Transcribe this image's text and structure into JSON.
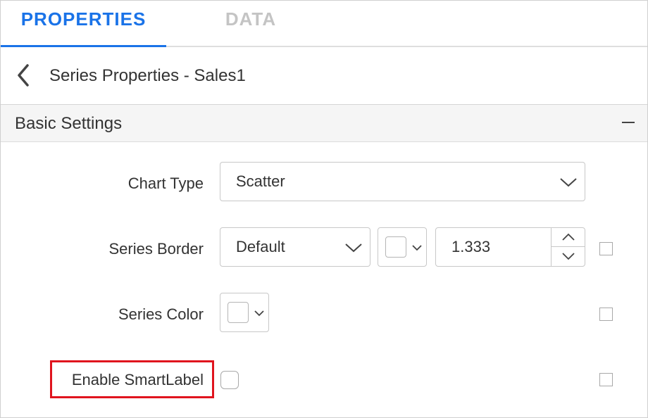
{
  "tabs": {
    "properties_label": "PROPERTIES",
    "data_label": "DATA"
  },
  "header": {
    "title": "Series Properties - Sales1",
    "back_icon": "chevron-left-icon"
  },
  "section": {
    "title": "Basic Settings",
    "collapse_icon": "minus-icon"
  },
  "fields": {
    "chart_type": {
      "label": "Chart Type",
      "value": "Scatter"
    },
    "series_border": {
      "label": "Series Border",
      "style_value": "Default",
      "color": "#ffffff",
      "width_value": "1.333"
    },
    "series_color": {
      "label": "Series Color",
      "color": "#ffffff"
    },
    "enable_smartlabel": {
      "label": "Enable SmartLabel",
      "checked": false
    }
  },
  "colors": {
    "accent": "#1a73e8",
    "inactive_tab": "#c4c4c4",
    "highlight": "#e0141e",
    "section_bg": "#f5f5f5"
  }
}
